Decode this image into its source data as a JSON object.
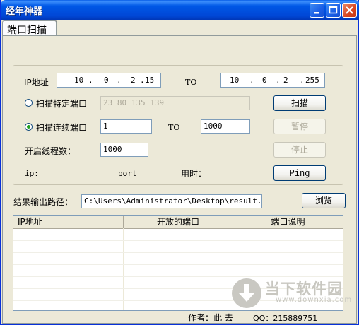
{
  "window": {
    "title": "经年神器"
  },
  "tabs": [
    {
      "label": "端口扫描"
    }
  ],
  "scan": {
    "ip_label": "IP地址",
    "ip_start": [
      "10",
      "0",
      "2",
      "15"
    ],
    "to_label": "TO",
    "ip_end": [
      "10",
      "0",
      "2",
      "255"
    ],
    "specific_ports_label": "扫描特定端口",
    "specific_ports_value": "23 80 135 139",
    "continuous_ports_label": "扫描连续端口",
    "port_from": "1",
    "port_to_label": "TO",
    "port_to": "1000",
    "threads_label": "开启线程数：",
    "threads_value": "1000",
    "ip_status_label": "ip:",
    "port_status_label": "port",
    "time_label": "用时：",
    "specific_selected": false,
    "continuous_selected": true
  },
  "buttons": {
    "scan": "扫描",
    "pause": "暂停",
    "stop": "停止",
    "ping": "Ping",
    "browse": "浏览"
  },
  "output": {
    "label": "结果输出路径：",
    "path": "C:\\Users\\Administrator\\Desktop\\result.txt"
  },
  "results_table": {
    "columns": [
      "IP地址",
      "开放的端口",
      "端口说明"
    ],
    "rows": []
  },
  "footer": {
    "author": "作者：此  去",
    "qq": "QQ：215889751"
  },
  "watermark": {
    "name": "当下软件园",
    "url": "www.downxia.com"
  }
}
